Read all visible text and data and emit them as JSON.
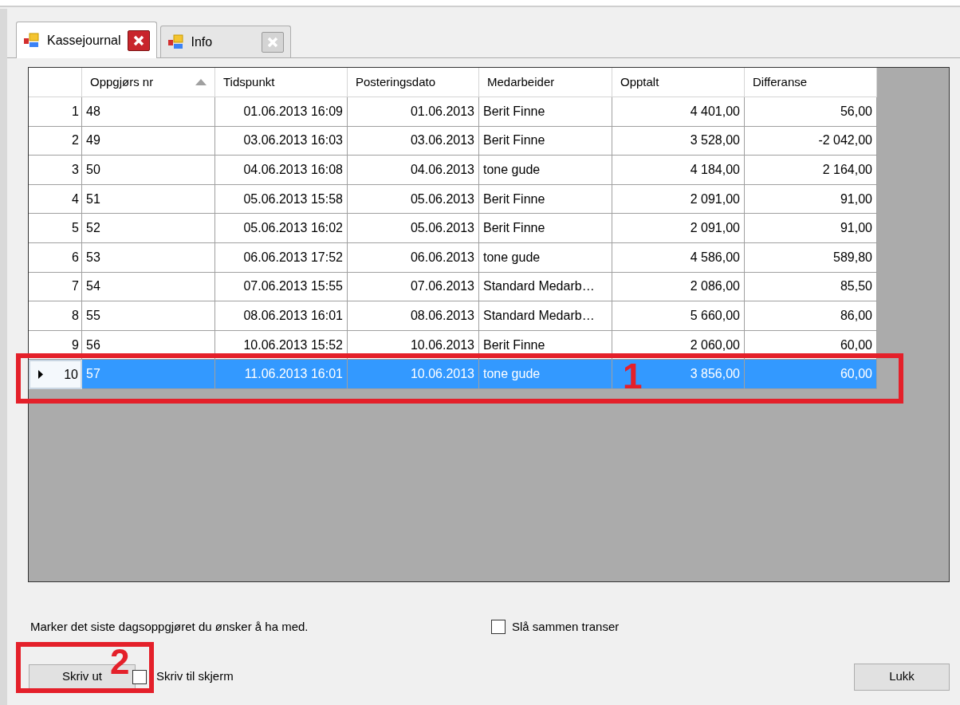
{
  "tabs": [
    {
      "label": "Kassejournal",
      "selected": true
    },
    {
      "label": "Info",
      "selected": false
    }
  ],
  "table": {
    "columns": [
      {
        "label": "Oppgjørs nr",
        "sorted": true
      },
      {
        "label": "Tidspunkt",
        "sorted": false
      },
      {
        "label": "Posteringsdato",
        "sorted": false
      },
      {
        "label": "Medarbeider",
        "sorted": false
      },
      {
        "label": "Opptalt",
        "sorted": false
      },
      {
        "label": "Differanse",
        "sorted": false
      }
    ],
    "rows": [
      {
        "number": "1",
        "cells": [
          "48",
          "01.06.2013 16:09",
          "01.06.2013",
          "Berit Finne",
          "4 401,00",
          "56,00"
        ],
        "selected": false
      },
      {
        "number": "2",
        "cells": [
          "49",
          "03.06.2013 16:03",
          "03.06.2013",
          "Berit Finne",
          "3 528,00",
          "-2 042,00"
        ],
        "selected": false
      },
      {
        "number": "3",
        "cells": [
          "50",
          "04.06.2013 16:08",
          "04.06.2013",
          "tone gude",
          "4 184,00",
          "2 164,00"
        ],
        "selected": false
      },
      {
        "number": "4",
        "cells": [
          "51",
          "05.06.2013 15:58",
          "05.06.2013",
          "Berit Finne",
          "2 091,00",
          "91,00"
        ],
        "selected": false
      },
      {
        "number": "5",
        "cells": [
          "52",
          "05.06.2013 16:02",
          "05.06.2013",
          "Berit Finne",
          "2 091,00",
          "91,00"
        ],
        "selected": false
      },
      {
        "number": "6",
        "cells": [
          "53",
          "06.06.2013 17:52",
          "06.06.2013",
          "tone gude",
          "4 586,00",
          "589,80"
        ],
        "selected": false
      },
      {
        "number": "7",
        "cells": [
          "54",
          "07.06.2013 15:55",
          "07.06.2013",
          "Standard Medarb…",
          "2 086,00",
          "85,50"
        ],
        "selected": false
      },
      {
        "number": "8",
        "cells": [
          "55",
          "08.06.2013 16:01",
          "08.06.2013",
          "Standard Medarb…",
          "5 660,00",
          "86,00"
        ],
        "selected": false
      },
      {
        "number": "9",
        "cells": [
          "56",
          "10.06.2013 15:52",
          "10.06.2013",
          "Berit Finne",
          "2 060,00",
          "60,00"
        ],
        "selected": false
      },
      {
        "number": "10",
        "cells": [
          "57",
          "11.06.2013 16:01",
          "10.06.2013",
          "tone gude",
          "3 856,00",
          "60,00"
        ],
        "selected": true
      }
    ]
  },
  "hint": "Marker det siste dagsoppgjøret du ønsker å ha med.",
  "merge_checkbox": {
    "label": "Slå sammen transer",
    "checked": false
  },
  "print_button": "Skriv ut",
  "screen_checkbox": {
    "label": "Skriv til skjerm",
    "checked": false
  },
  "close_button": "Lukk",
  "annotations": [
    {
      "label": "1"
    },
    {
      "label": "2"
    }
  ]
}
